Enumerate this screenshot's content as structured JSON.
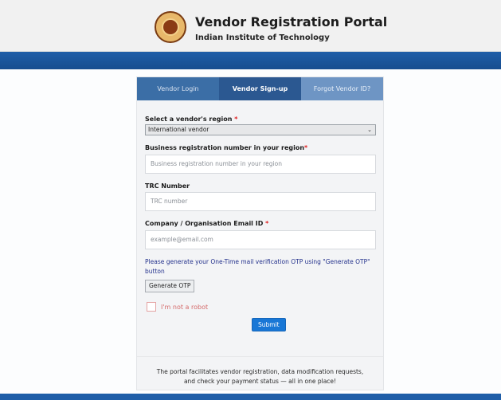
{
  "header": {
    "title": "Vendor Registration Portal",
    "subtitle": "Indian Institute of Technology",
    "logo_icon": "institute-seal-logo"
  },
  "tabs": [
    {
      "label": "Vendor Login",
      "active": false
    },
    {
      "label": "Vendor Sign-up",
      "active": true
    },
    {
      "label": "Forgot Vendor ID?",
      "active": false
    }
  ],
  "form": {
    "region": {
      "label": "Select a vendor's region",
      "required_mark": "*",
      "selected": "International vendor"
    },
    "brn": {
      "label": "Business registration number in your region",
      "required_mark": "*",
      "placeholder": "Business registration number in your region"
    },
    "trc": {
      "label": "TRC Number",
      "placeholder": "TRC number"
    },
    "email": {
      "label": "Company / Organisation Email ID",
      "required_mark": "*",
      "placeholder": "example@email.com"
    },
    "otp_note": "Please generate your One-Time mail verification OTP using \"Generate OTP\" button",
    "otp_button": "Generate OTP",
    "captcha_label": "I'm not a robot",
    "submit_label": "Submit"
  },
  "footer": {
    "line1": "The portal facilitates vendor registration, data modification requests,",
    "line2": "and check your payment status — all in one place!"
  },
  "colors": {
    "header_bar": "#1f5ea8",
    "active_tab": "#2b5891",
    "submit": "#1877d6",
    "required": "#e02020",
    "note": "#23318c"
  }
}
